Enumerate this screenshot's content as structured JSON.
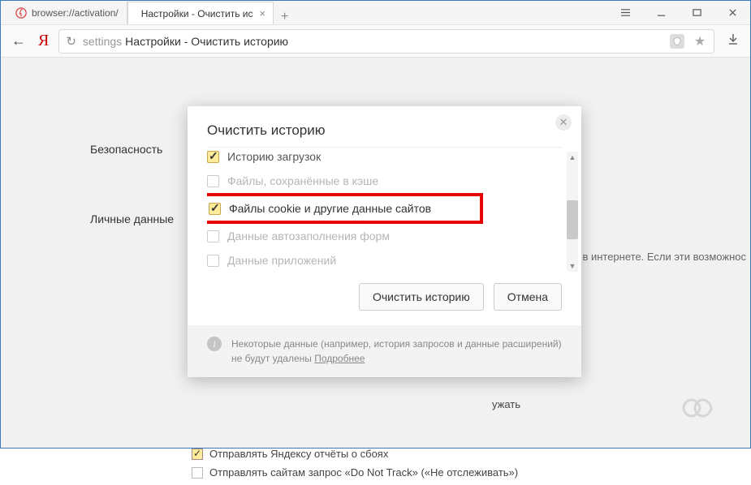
{
  "titlebar": {
    "tabs": [
      {
        "label": "browser://activation/"
      },
      {
        "label": "Настройки - Очистить ис"
      }
    ]
  },
  "addr": {
    "url_scheme": "settings",
    "url_rest": "Настройки - Очистить историю"
  },
  "sidebar": {
    "security": "Безопасность",
    "personal": "Личные данные"
  },
  "bg": {
    "hint_text": "в интернете. Если эти возможнос",
    "row_serve": "ужать",
    "row_reports": "Отправлять Яндексу отчёты о сбоях",
    "row_dnt": "Отправлять сайтам запрос «Do Not Track» («Не отслеживать»)"
  },
  "dialog": {
    "title": "Очистить историю",
    "opts": {
      "downloads": "Историю загрузок",
      "cache": "Файлы, сохранённые в кэше",
      "cookies": "Файлы cookie и другие данные сайтов",
      "autofill": "Данные автозаполнения форм",
      "appdata": "Данные приложений"
    },
    "clear_btn": "Очистить историю",
    "cancel_btn": "Отмена",
    "footer_text": "Некоторые данные (например, история запросов и данные расширений) не будут удалены ",
    "footer_link": "Подробнее"
  }
}
